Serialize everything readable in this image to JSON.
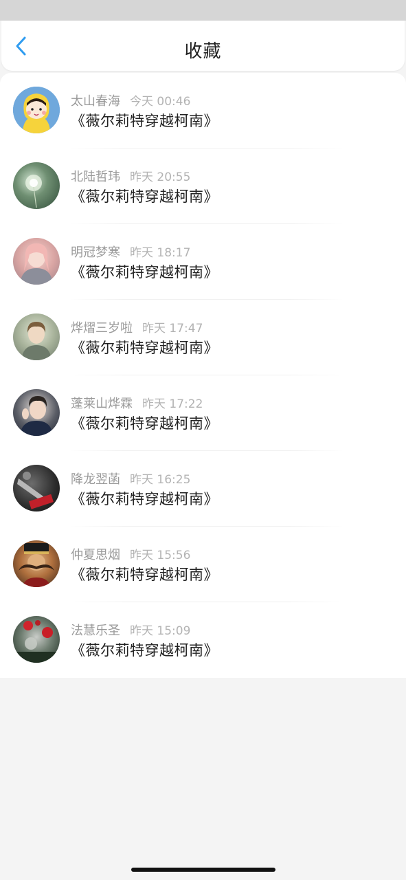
{
  "nav": {
    "title": "收藏",
    "back_icon": "chevron-left-icon"
  },
  "colors": {
    "accent": "#2f9cf0",
    "background": "#f4f4f4",
    "name_text": "#9a9a9a",
    "time_text": "#b3b3b3"
  },
  "favorites": [
    {
      "name": "太山春海",
      "time": "今天 00:46",
      "title": "《薇尔莉特穿越柯南》"
    },
    {
      "name": "北陆哲玮",
      "time": "昨天 20:55",
      "title": "《薇尔莉特穿越柯南》"
    },
    {
      "name": "明冠梦寒",
      "time": "昨天 18:17",
      "title": "《薇尔莉特穿越柯南》"
    },
    {
      "name": "烨熠三岁啦",
      "time": "昨天 17:47",
      "title": "《薇尔莉特穿越柯南》"
    },
    {
      "name": "蓬莱山烨霖",
      "time": "昨天 17:22",
      "title": "《薇尔莉特穿越柯南》"
    },
    {
      "name": "降龙翌菡",
      "time": "昨天 16:25",
      "title": "《薇尔莉特穿越柯南》"
    },
    {
      "name": "仲夏思烟",
      "time": "昨天 15:56",
      "title": "《薇尔莉特穿越柯南》"
    },
    {
      "name": "法慧乐圣",
      "time": "昨天 15:09",
      "title": "《薇尔莉特穿越柯南》"
    }
  ]
}
